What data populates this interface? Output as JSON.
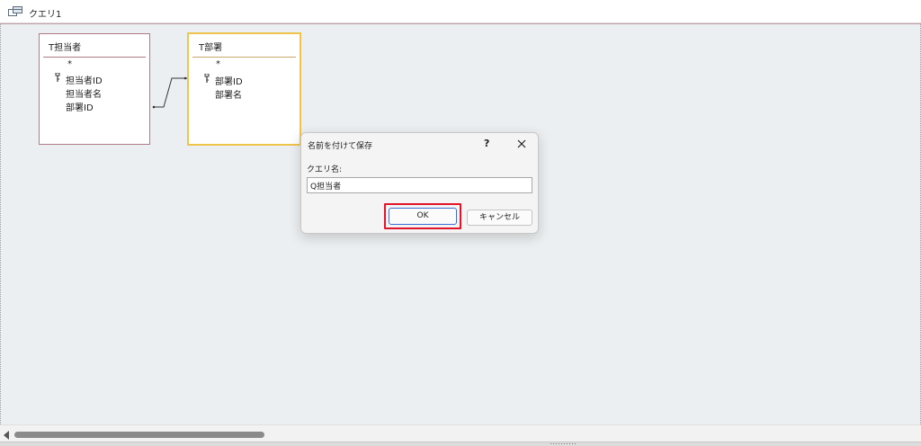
{
  "window": {
    "tab_title": "クエリ1",
    "tab_icon": "query-icon"
  },
  "tables": [
    {
      "title": "T担当者",
      "fields": [
        {
          "name": "*",
          "key": false
        },
        {
          "name": "担当者ID",
          "key": true
        },
        {
          "name": "担当者名",
          "key": false
        },
        {
          "name": "部署ID",
          "key": false
        }
      ]
    },
    {
      "title": "T部署",
      "fields": [
        {
          "name": "*",
          "key": false
        },
        {
          "name": "部署ID",
          "key": true
        },
        {
          "name": "部署名",
          "key": false
        }
      ]
    }
  ],
  "dialog": {
    "title": "名前を付けて保存",
    "help_label": "?",
    "close_icon": "close-icon",
    "field_label": "クエリ名:",
    "input_value": "Q担当者",
    "ok_label": "OK",
    "cancel_label": "キャンセル"
  },
  "colors": {
    "design_background": "#eceff1",
    "table1_border": "#b07a86",
    "table2_border_selected": "#f0c44c",
    "ok_highlight": "#e2142a",
    "ok_focus_border": "#3b6fd1"
  }
}
